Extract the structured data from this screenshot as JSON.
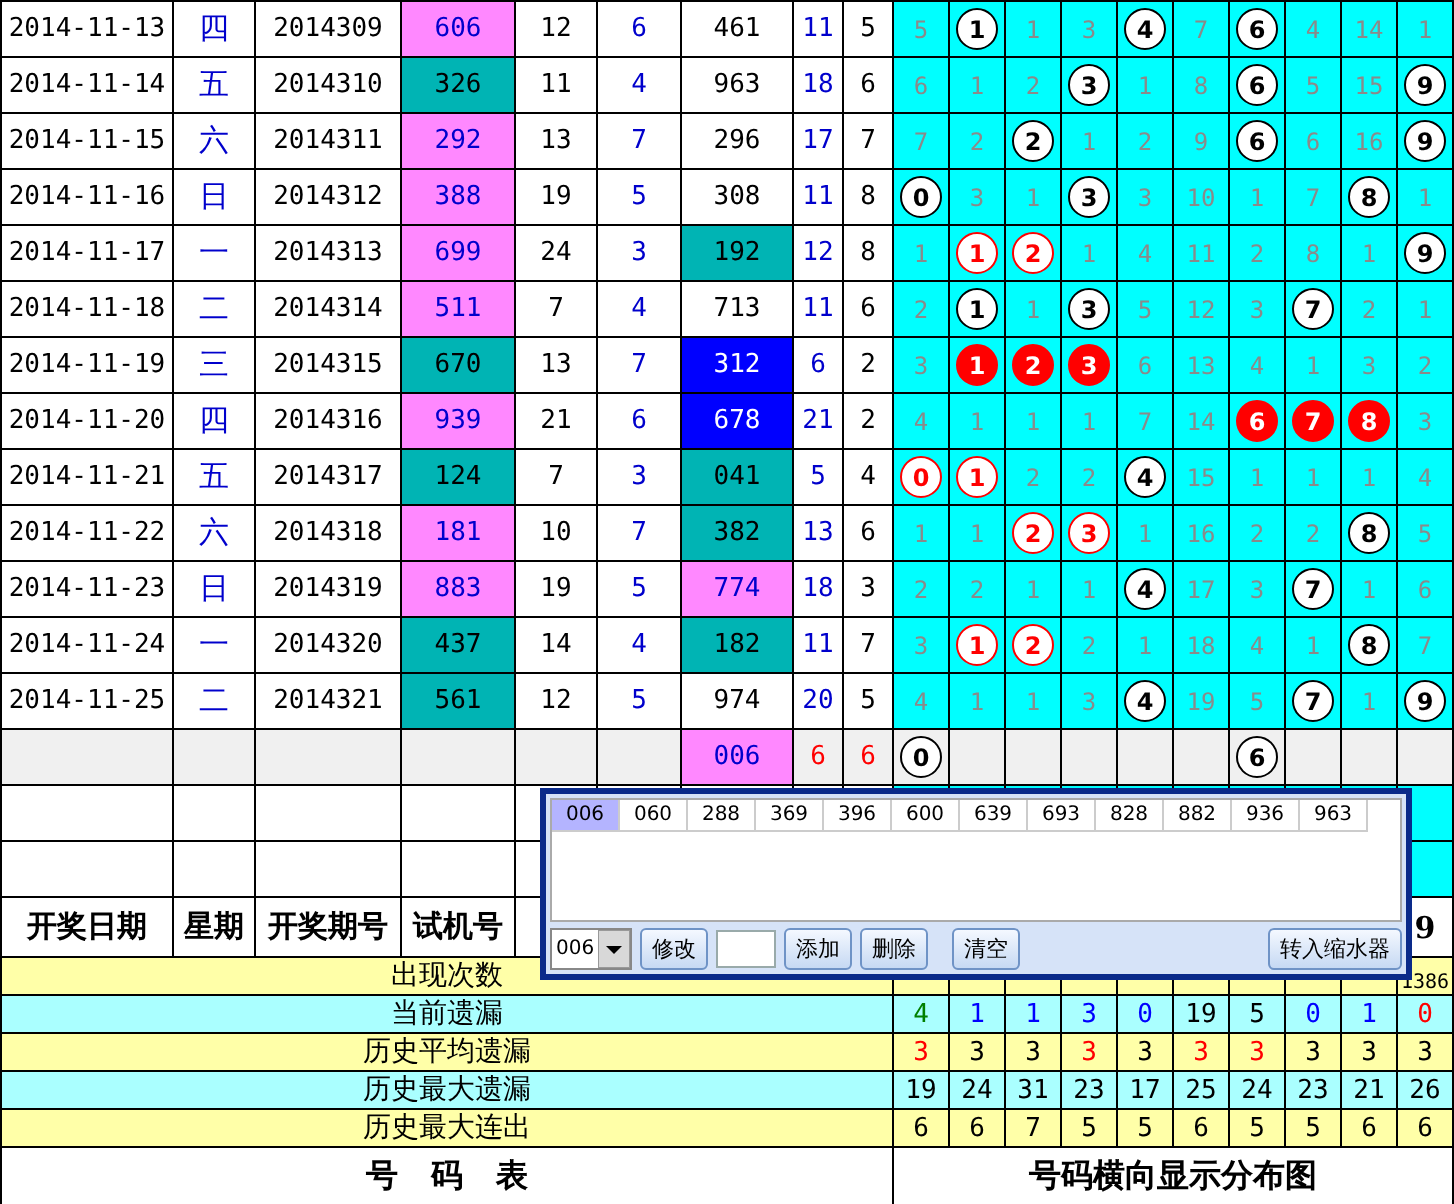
{
  "rows": [
    {
      "date": "2014-11-13",
      "week": "四",
      "issue": "2014309",
      "test": {
        "text": "606",
        "color": "#ff88ff"
      },
      "sum": "12",
      "span": "6",
      "num2": {
        "text": "461"
      },
      "c9": "11",
      "c10": "5",
      "dist": [
        {
          "kind": "miss",
          "text": "5"
        },
        {
          "kind": "ball",
          "text": "1"
        },
        {
          "kind": "miss",
          "text": "1"
        },
        {
          "kind": "miss",
          "text": "3"
        },
        {
          "kind": "ball",
          "text": "4"
        },
        {
          "kind": "miss",
          "text": "7"
        },
        {
          "kind": "ball",
          "text": "6"
        },
        {
          "kind": "miss",
          "text": "4"
        },
        {
          "kind": "miss",
          "text": "14"
        },
        {
          "kind": "miss",
          "text": "1"
        }
      ]
    },
    {
      "date": "2014-11-14",
      "week": "五",
      "issue": "2014310",
      "test": {
        "text": "326",
        "color": "#00b4b4"
      },
      "sum": "11",
      "span": "4",
      "num2": {
        "text": "963"
      },
      "c9": "18",
      "c10": "6",
      "dist": [
        {
          "kind": "miss",
          "text": "6"
        },
        {
          "kind": "miss",
          "text": "1"
        },
        {
          "kind": "miss",
          "text": "2"
        },
        {
          "kind": "ball",
          "text": "3"
        },
        {
          "kind": "miss",
          "text": "1"
        },
        {
          "kind": "miss",
          "text": "8"
        },
        {
          "kind": "ball",
          "text": "6"
        },
        {
          "kind": "miss",
          "text": "5"
        },
        {
          "kind": "miss",
          "text": "15"
        },
        {
          "kind": "ball",
          "text": "9"
        }
      ]
    },
    {
      "date": "2014-11-15",
      "week": "六",
      "issue": "2014311",
      "test": {
        "text": "292",
        "color": "#ff88ff"
      },
      "sum": "13",
      "span": "7",
      "num2": {
        "text": "296"
      },
      "c9": "17",
      "c10": "7",
      "dist": [
        {
          "kind": "miss",
          "text": "7"
        },
        {
          "kind": "miss",
          "text": "2"
        },
        {
          "kind": "ball",
          "text": "2"
        },
        {
          "kind": "miss",
          "text": "1"
        },
        {
          "kind": "miss",
          "text": "2"
        },
        {
          "kind": "miss",
          "text": "9"
        },
        {
          "kind": "ball",
          "text": "6"
        },
        {
          "kind": "miss",
          "text": "6"
        },
        {
          "kind": "miss",
          "text": "16"
        },
        {
          "kind": "ball",
          "text": "9"
        }
      ]
    },
    {
      "date": "2014-11-16",
      "week": "日",
      "issue": "2014312",
      "test": {
        "text": "388",
        "color": "#ff88ff"
      },
      "sum": "19",
      "span": "5",
      "num2": {
        "text": "308"
      },
      "c9": "11",
      "c10": "8",
      "dist": [
        {
          "kind": "ball",
          "text": "0"
        },
        {
          "kind": "miss",
          "text": "3"
        },
        {
          "kind": "miss",
          "text": "1"
        },
        {
          "kind": "ball",
          "text": "3"
        },
        {
          "kind": "miss",
          "text": "3"
        },
        {
          "kind": "miss",
          "text": "10"
        },
        {
          "kind": "miss",
          "text": "1"
        },
        {
          "kind": "miss",
          "text": "7"
        },
        {
          "kind": "ball",
          "text": "8"
        },
        {
          "kind": "miss",
          "text": "1"
        }
      ]
    },
    {
      "date": "2014-11-17",
      "week": "一",
      "issue": "2014313",
      "test": {
        "text": "699",
        "color": "#ff88ff"
      },
      "sum": "24",
      "span": "3",
      "num2": {
        "text": "192",
        "color": "#00b4b4"
      },
      "c9": "12",
      "c10": "8",
      "dist": [
        {
          "kind": "miss",
          "text": "1"
        },
        {
          "kind": "ring",
          "text": "1"
        },
        {
          "kind": "ring",
          "text": "2"
        },
        {
          "kind": "miss",
          "text": "1"
        },
        {
          "kind": "miss",
          "text": "4"
        },
        {
          "kind": "miss",
          "text": "11"
        },
        {
          "kind": "miss",
          "text": "2"
        },
        {
          "kind": "miss",
          "text": "8"
        },
        {
          "kind": "miss",
          "text": "1"
        },
        {
          "kind": "ball",
          "text": "9"
        }
      ]
    },
    {
      "date": "2014-11-18",
      "week": "二",
      "issue": "2014314",
      "test": {
        "text": "511",
        "color": "#ff88ff"
      },
      "sum": "7",
      "span": "4",
      "num2": {
        "text": "713"
      },
      "c9": "11",
      "c10": "6",
      "dist": [
        {
          "kind": "miss",
          "text": "2"
        },
        {
          "kind": "ball",
          "text": "1"
        },
        {
          "kind": "miss",
          "text": "1"
        },
        {
          "kind": "ball",
          "text": "3"
        },
        {
          "kind": "miss",
          "text": "5"
        },
        {
          "kind": "miss",
          "text": "12"
        },
        {
          "kind": "miss",
          "text": "3"
        },
        {
          "kind": "ball",
          "text": "7"
        },
        {
          "kind": "miss",
          "text": "2"
        },
        {
          "kind": "miss",
          "text": "1"
        }
      ]
    },
    {
      "date": "2014-11-19",
      "week": "三",
      "issue": "2014315",
      "test": {
        "text": "670",
        "color": "#00b4b4"
      },
      "sum": "13",
      "span": "7",
      "num2": {
        "text": "312",
        "color": "#0000ff"
      },
      "c9": "6",
      "c10": "2",
      "dist": [
        {
          "kind": "miss",
          "text": "3"
        },
        {
          "kind": "hit",
          "text": "1"
        },
        {
          "kind": "hit",
          "text": "2"
        },
        {
          "kind": "hit",
          "text": "3"
        },
        {
          "kind": "miss",
          "text": "6"
        },
        {
          "kind": "miss",
          "text": "13"
        },
        {
          "kind": "miss",
          "text": "4"
        },
        {
          "kind": "miss",
          "text": "1"
        },
        {
          "kind": "miss",
          "text": "3"
        },
        {
          "kind": "miss",
          "text": "2"
        }
      ]
    },
    {
      "date": "2014-11-20",
      "week": "四",
      "issue": "2014316",
      "test": {
        "text": "939",
        "color": "#ff88ff"
      },
      "sum": "21",
      "span": "6",
      "num2": {
        "text": "678",
        "color": "#0000ff"
      },
      "c9": "21",
      "c10": "2",
      "dist": [
        {
          "kind": "miss",
          "text": "4"
        },
        {
          "kind": "miss",
          "text": "1"
        },
        {
          "kind": "miss",
          "text": "1"
        },
        {
          "kind": "miss",
          "text": "1"
        },
        {
          "kind": "miss",
          "text": "7"
        },
        {
          "kind": "miss",
          "text": "14"
        },
        {
          "kind": "hit",
          "text": "6"
        },
        {
          "kind": "hit",
          "text": "7"
        },
        {
          "kind": "hit",
          "text": "8"
        },
        {
          "kind": "miss",
          "text": "3"
        }
      ]
    },
    {
      "date": "2014-11-21",
      "week": "五",
      "issue": "2014317",
      "test": {
        "text": "124",
        "color": "#00b4b4"
      },
      "sum": "7",
      "span": "3",
      "num2": {
        "text": "041",
        "color": "#00b4b4"
      },
      "c9": "5",
      "c10": "4",
      "dist": [
        {
          "kind": "ring",
          "text": "0"
        },
        {
          "kind": "ring",
          "text": "1"
        },
        {
          "kind": "miss",
          "text": "2"
        },
        {
          "kind": "miss",
          "text": "2"
        },
        {
          "kind": "ball",
          "text": "4"
        },
        {
          "kind": "miss",
          "text": "15"
        },
        {
          "kind": "miss",
          "text": "1"
        },
        {
          "kind": "miss",
          "text": "1"
        },
        {
          "kind": "miss",
          "text": "1"
        },
        {
          "kind": "miss",
          "text": "4"
        }
      ]
    },
    {
      "date": "2014-11-22",
      "week": "六",
      "issue": "2014318",
      "test": {
        "text": "181",
        "color": "#ff88ff"
      },
      "sum": "10",
      "span": "7",
      "num2": {
        "text": "382",
        "color": "#00b4b4"
      },
      "c9": "13",
      "c10": "6",
      "dist": [
        {
          "kind": "miss",
          "text": "1"
        },
        {
          "kind": "miss",
          "text": "1"
        },
        {
          "kind": "ring",
          "text": "2"
        },
        {
          "kind": "ring",
          "text": "3"
        },
        {
          "kind": "miss",
          "text": "1"
        },
        {
          "kind": "miss",
          "text": "16"
        },
        {
          "kind": "miss",
          "text": "2"
        },
        {
          "kind": "miss",
          "text": "2"
        },
        {
          "kind": "ball",
          "text": "8"
        },
        {
          "kind": "miss",
          "text": "5"
        }
      ]
    },
    {
      "date": "2014-11-23",
      "week": "日",
      "issue": "2014319",
      "test": {
        "text": "883",
        "color": "#ff88ff"
      },
      "sum": "19",
      "span": "5",
      "num2": {
        "text": "774",
        "color": "#ff88ff"
      },
      "c9": "18",
      "c10": "3",
      "dist": [
        {
          "kind": "miss",
          "text": "2"
        },
        {
          "kind": "miss",
          "text": "2"
        },
        {
          "kind": "miss",
          "text": "1"
        },
        {
          "kind": "miss",
          "text": "1"
        },
        {
          "kind": "ball",
          "text": "4"
        },
        {
          "kind": "miss",
          "text": "17"
        },
        {
          "kind": "miss",
          "text": "3"
        },
        {
          "kind": "ball",
          "text": "7"
        },
        {
          "kind": "miss",
          "text": "1"
        },
        {
          "kind": "miss",
          "text": "6"
        }
      ]
    },
    {
      "date": "2014-11-24",
      "week": "一",
      "issue": "2014320",
      "test": {
        "text": "437",
        "color": "#00b4b4"
      },
      "sum": "14",
      "span": "4",
      "num2": {
        "text": "182",
        "color": "#00b4b4"
      },
      "c9": "11",
      "c10": "7",
      "dist": [
        {
          "kind": "miss",
          "text": "3"
        },
        {
          "kind": "ring",
          "text": "1"
        },
        {
          "kind": "ring",
          "text": "2"
        },
        {
          "kind": "miss",
          "text": "2"
        },
        {
          "kind": "miss",
          "text": "1"
        },
        {
          "kind": "miss",
          "text": "18"
        },
        {
          "kind": "miss",
          "text": "4"
        },
        {
          "kind": "miss",
          "text": "1"
        },
        {
          "kind": "ball",
          "text": "8"
        },
        {
          "kind": "miss",
          "text": "7"
        }
      ]
    },
    {
      "date": "2014-11-25",
      "week": "二",
      "issue": "2014321",
      "test": {
        "text": "561",
        "color": "#00b4b4"
      },
      "sum": "12",
      "span": "5",
      "num2": {
        "text": "974"
      },
      "c9": "20",
      "c10": "5",
      "dist": [
        {
          "kind": "miss",
          "text": "4"
        },
        {
          "kind": "miss",
          "text": "1"
        },
        {
          "kind": "miss",
          "text": "1"
        },
        {
          "kind": "miss",
          "text": "3"
        },
        {
          "kind": "ball",
          "text": "4"
        },
        {
          "kind": "miss",
          "text": "19"
        },
        {
          "kind": "miss",
          "text": "5"
        },
        {
          "kind": "ball",
          "text": "7"
        },
        {
          "kind": "miss",
          "text": "1"
        },
        {
          "kind": "ball",
          "text": "9"
        }
      ]
    }
  ],
  "pending_row": {
    "num2": {
      "text": "006",
      "color": "#ff88ff"
    },
    "c9": "6",
    "c10": "6",
    "dist": [
      {
        "kind": "ball",
        "text": "0"
      },
      {
        "kind": "blank"
      },
      {
        "kind": "blank"
      },
      {
        "kind": "blank"
      },
      {
        "kind": "blank"
      },
      {
        "kind": "blank"
      },
      {
        "kind": "ball",
        "text": "6"
      },
      {
        "kind": "blank"
      },
      {
        "kind": "blank"
      },
      {
        "kind": "blank"
      }
    ]
  },
  "header": [
    "开奖日期",
    "星期",
    "开奖期号",
    "试机号"
  ],
  "header_last": "9",
  "stats": [
    {
      "label": "出现次数",
      "last": "1386"
    },
    {
      "label": "当前遗漏",
      "values": [
        {
          "text": "4",
          "kind": "low"
        },
        {
          "text": "1",
          "kind": "cold"
        },
        {
          "text": "1",
          "kind": "cold"
        },
        {
          "text": "3",
          "kind": "cold"
        },
        {
          "text": "0",
          "kind": "cold"
        },
        {
          "text": "19",
          "kind": "plain"
        },
        {
          "text": "5",
          "kind": "plain"
        },
        {
          "text": "0",
          "kind": "cold"
        },
        {
          "text": "1",
          "kind": "cold"
        },
        {
          "text": "0",
          "kind": "hot"
        }
      ]
    },
    {
      "label": "历史平均遗漏",
      "values": [
        {
          "text": "3",
          "kind": "hot"
        },
        {
          "text": "3",
          "kind": "plain"
        },
        {
          "text": "3",
          "kind": "plain"
        },
        {
          "text": "3",
          "kind": "hot"
        },
        {
          "text": "3",
          "kind": "plain"
        },
        {
          "text": "3",
          "kind": "hot"
        },
        {
          "text": "3",
          "kind": "hot"
        },
        {
          "text": "3",
          "kind": "plain"
        },
        {
          "text": "3",
          "kind": "plain"
        },
        {
          "text": "3",
          "kind": "plain"
        }
      ]
    },
    {
      "label": "历史最大遗漏",
      "values": [
        {
          "text": "19"
        },
        {
          "text": "24"
        },
        {
          "text": "31"
        },
        {
          "text": "23"
        },
        {
          "text": "17"
        },
        {
          "text": "25"
        },
        {
          "text": "24"
        },
        {
          "text": "23"
        },
        {
          "text": "21"
        },
        {
          "text": "26"
        }
      ]
    },
    {
      "label": "历史最大连出",
      "values": [
        {
          "text": "6"
        },
        {
          "text": "6"
        },
        {
          "text": "7"
        },
        {
          "text": "5"
        },
        {
          "text": "5"
        },
        {
          "text": "6"
        },
        {
          "text": "5"
        },
        {
          "text": "5"
        },
        {
          "text": "6"
        },
        {
          "text": "6"
        }
      ]
    }
  ],
  "footer": [
    "号   码   表",
    "号码横向显示分布图"
  ],
  "popup": {
    "numbers": [
      {
        "text": "006",
        "selected": true
      },
      {
        "text": "060",
        "selected": false
      },
      {
        "text": "288",
        "selected": false
      },
      {
        "text": "369",
        "selected": false
      },
      {
        "text": "396",
        "selected": false
      },
      {
        "text": "600",
        "selected": false
      },
      {
        "text": "639",
        "selected": false
      },
      {
        "text": "693",
        "selected": false
      },
      {
        "text": "828",
        "selected": false
      },
      {
        "text": "882",
        "selected": false
      },
      {
        "text": "936",
        "selected": false
      },
      {
        "text": "963",
        "selected": false
      }
    ],
    "combo": "006",
    "buttons": [
      "修改",
      "添加",
      "删除",
      "清空"
    ],
    "transfer": "转入缩水器"
  }
}
